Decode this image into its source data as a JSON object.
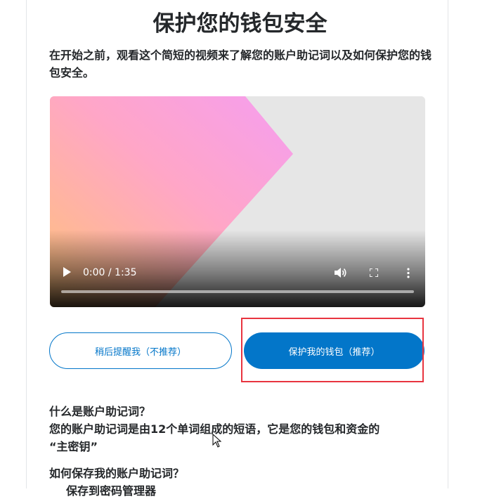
{
  "page": {
    "title": "保护您的钱包安全",
    "intro": "在开始之前，观看这个简短的视频来了解您的账户助记词以及如何保护您的钱包安全。"
  },
  "video": {
    "time": "0:00 / 1:35",
    "progress": 0,
    "icons": {
      "play": "play-icon",
      "volume": "volume-icon",
      "fullscreen": "fullscreen-icon",
      "more": "more-options-icon"
    }
  },
  "buttons": {
    "remind_later": "稍后提醒我（不推荐）",
    "secure_wallet": "保护我的钱包（推荐）"
  },
  "faq": {
    "q1": "什么是账户助记词？",
    "a1_line1": "您的账户助记词是由12个单词组成的短语，它是您的钱包和资金的",
    "a1_line2": "“主密钥”",
    "q2": "如何保存我的账户助记词？",
    "a2_partial": "保存到密码管理器"
  },
  "colors": {
    "primary": "#0376c9",
    "highlight": "#e8343f",
    "text": "#24272a"
  }
}
